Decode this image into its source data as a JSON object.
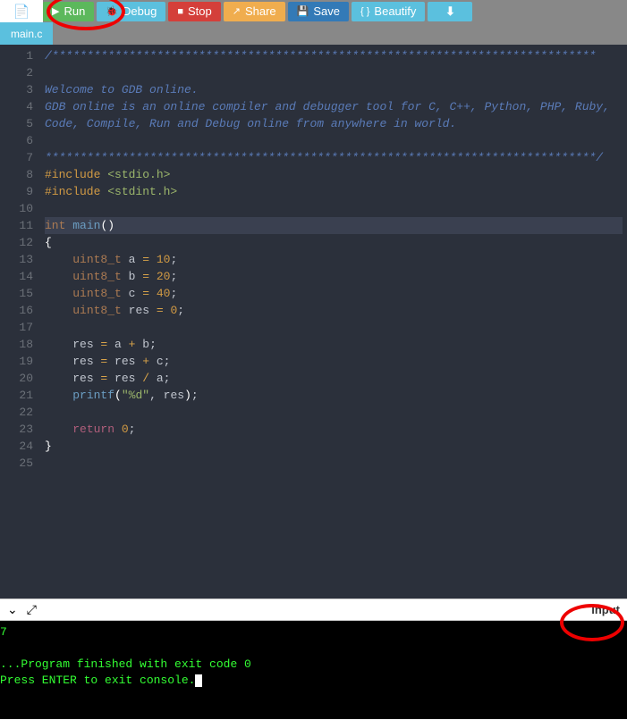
{
  "toolbar": {
    "run": "Run",
    "debug": "Debug",
    "stop": "Stop",
    "share": "Share",
    "save": "Save",
    "beautify": "Beautify"
  },
  "tab": {
    "name": "main.c"
  },
  "gutter": [
    "1",
    "2",
    "3",
    "4",
    "5",
    "6",
    "7",
    "8",
    "9",
    "10",
    "11",
    "12",
    "13",
    "14",
    "15",
    "16",
    "17",
    "18",
    "19",
    "20",
    "21",
    "22",
    "23",
    "24",
    "25"
  ],
  "code": {
    "l1": "/******************************************************************************",
    "l3a": "Welcome to GDB online.",
    "l4a": "GDB online is an online compiler and debugger tool for C, C++, Python, PHP, Ruby,",
    "l5a": "Code, Compile, Run and Debug online from anywhere in world.",
    "l7": "*******************************************************************************/",
    "inc": "#include ",
    "h1": "<stdio.h>",
    "h2": "<stdint.h>",
    "kint": "int",
    "kmain": "main",
    "lbrace": "{",
    "rbrace": "}",
    "u8": "uint8_t",
    "va": "a",
    "vb": "b",
    "vc": "c",
    "vres": "res",
    "eq": " = ",
    "n10": "10",
    "n20": "20",
    "n40": "40",
    "n0": "0",
    "semi": ";",
    "plus": " + ",
    "div": " / ",
    "printf": "printf",
    "fmt": "\"%d\"",
    "comma": ", ",
    "ret": "return",
    "sp4": "    ",
    "sp8": "        ",
    "lpar": "(",
    "rpar": ")"
  },
  "console_bar": {
    "input": "input"
  },
  "console": {
    "out": "7",
    "fin": "...Program finished with exit code 0",
    "prompt": "Press ENTER to exit console."
  }
}
